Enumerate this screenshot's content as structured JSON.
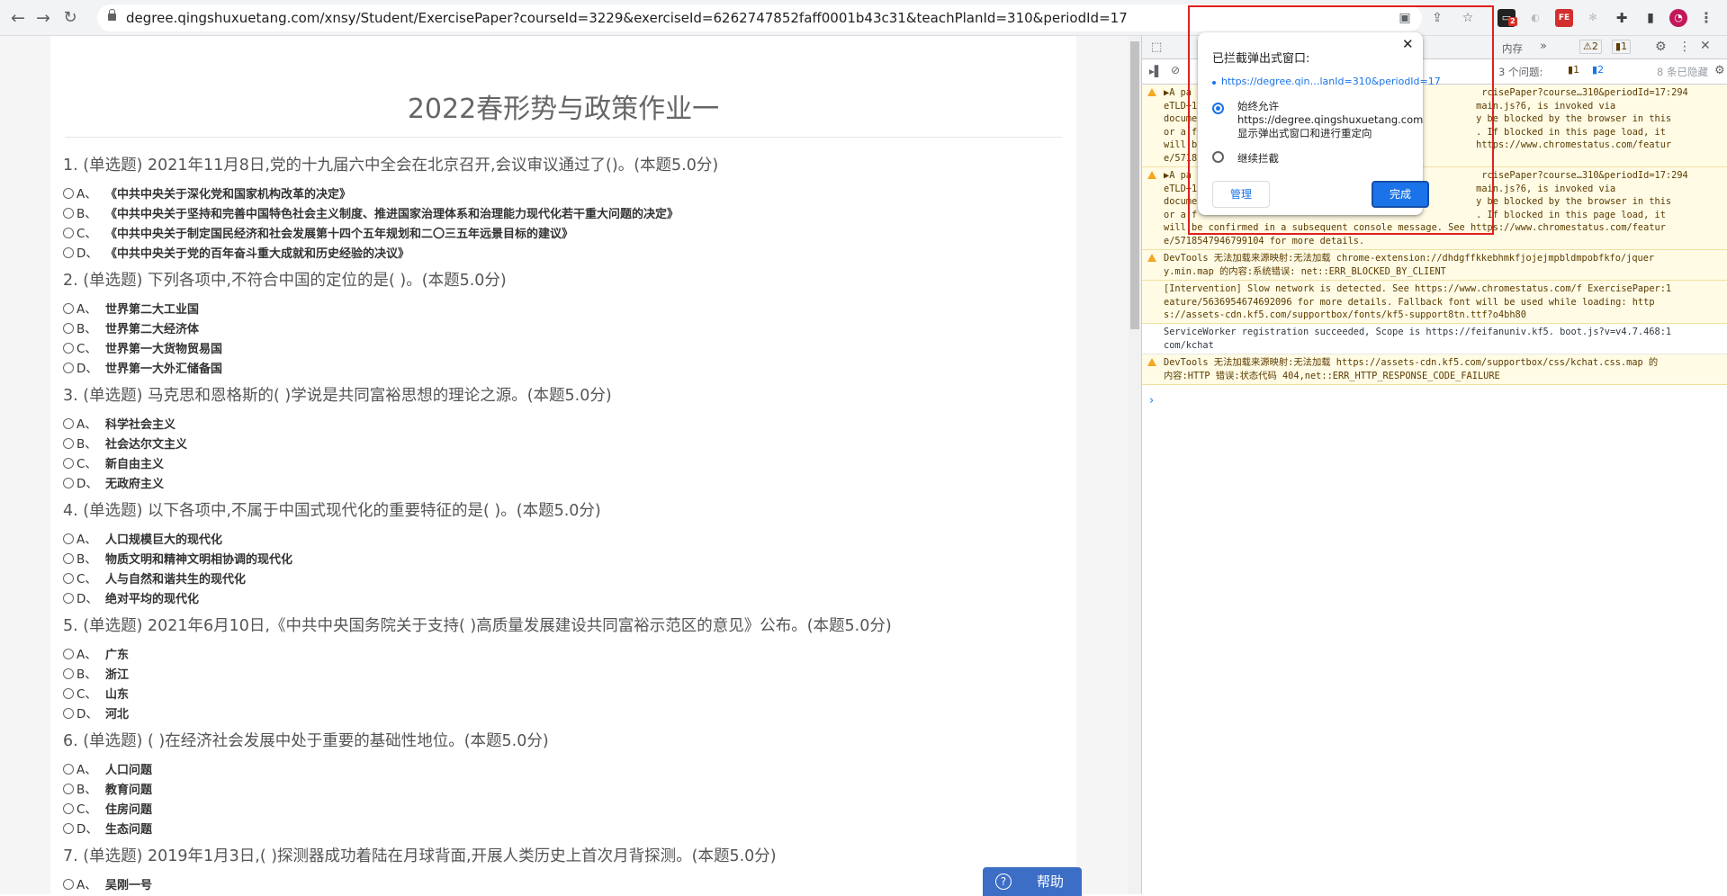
{
  "browser": {
    "url": "degree.qingshuxuetang.com/xnsy/Student/ExercisePaper?courseId=3229&exerciseId=6262747852faff0001b43c31&teachPlanId=310&periodId=17"
  },
  "paper": {
    "title": "2022春形势与政策作业一",
    "questions": [
      {
        "text": "1. (单选题) 2021年11月8日,党的十九届六中全会在北京召开,会议审议通过了()。(本题5.0分)",
        "options": [
          {
            "letter": "A、",
            "text": "《中共中央关于深化党和国家机构改革的决定》"
          },
          {
            "letter": "B、",
            "text": "《中共中央关于坚持和完善中国特色社会主义制度、推进国家治理体系和治理能力现代化若干重大问题的决定》"
          },
          {
            "letter": "C、",
            "text": "《中共中央关于制定国民经济和社会发展第十四个五年规划和二〇三五年远景目标的建议》"
          },
          {
            "letter": "D、",
            "text": "《中共中央关于党的百年奋斗重大成就和历史经验的决议》"
          }
        ]
      },
      {
        "text": "2. (单选题) 下列各项中,不符合中国的定位的是( )。(本题5.0分)",
        "options": [
          {
            "letter": "A、",
            "text": "世界第二大工业国"
          },
          {
            "letter": "B、",
            "text": "世界第二大经济体"
          },
          {
            "letter": "C、",
            "text": "世界第一大货物贸易国"
          },
          {
            "letter": "D、",
            "text": "世界第一大外汇储备国"
          }
        ]
      },
      {
        "text": "3. (单选题) 马克思和恩格斯的( )学说是共同富裕思想的理论之源。(本题5.0分)",
        "options": [
          {
            "letter": "A、",
            "text": "科学社会主义"
          },
          {
            "letter": "B、",
            "text": "社会达尔文主义"
          },
          {
            "letter": "C、",
            "text": "新自由主义"
          },
          {
            "letter": "D、",
            "text": "无政府主义"
          }
        ]
      },
      {
        "text": "4. (单选题) 以下各项中,不属于中国式现代化的重要特征的是( )。(本题5.0分)",
        "options": [
          {
            "letter": "A、",
            "text": "人口规模巨大的现代化"
          },
          {
            "letter": "B、",
            "text": "物质文明和精神文明相协调的现代化"
          },
          {
            "letter": "C、",
            "text": "人与自然和谐共生的现代化"
          },
          {
            "letter": "D、",
            "text": "绝对平均的现代化"
          }
        ]
      },
      {
        "text": "5. (单选题) 2021年6月10日,《中共中央国务院关于支持( )高质量发展建设共同富裕示范区的意见》公布。(本题5.0分)",
        "options": [
          {
            "letter": "A、",
            "text": "广东"
          },
          {
            "letter": "B、",
            "text": "浙江"
          },
          {
            "letter": "C、",
            "text": "山东"
          },
          {
            "letter": "D、",
            "text": "河北"
          }
        ]
      },
      {
        "text": "6. (单选题) ( )在经济社会发展中处于重要的基础性地位。(本题5.0分)",
        "options": [
          {
            "letter": "A、",
            "text": "人口问题"
          },
          {
            "letter": "B、",
            "text": "教育问题"
          },
          {
            "letter": "C、",
            "text": "住房问题"
          },
          {
            "letter": "D、",
            "text": "生态问题"
          }
        ]
      },
      {
        "text": "7. (单选题) 2019年1月3日,( )探测器成功着陆在月球背面,开展人类历史上首次月背探测。(本题5.0分)",
        "options": [
          {
            "letter": "A、",
            "text": "吴刚一号"
          }
        ]
      }
    ],
    "help_label": "帮助"
  },
  "devtools": {
    "tab_memory": "内存",
    "more_tabs": "»",
    "warn_count": "2",
    "issue_count": "1",
    "issues_label": "3 个问题:",
    "issues_warn": "1",
    "issues_info": "2",
    "hidden_label": "8 条已隐藏",
    "messages": [
      {
        "type": "warn",
        "text": "▶A pa                                                    rcisePaper?course…310&periodId=17:294\neTLD+1                                                  main.js?6, is invoked via\ndocume                                                  y be blocked by the browser in this\nor a f                                                  . If blocked in this page load, it\nwill b                                                  https://www.chromestatus.com/featur\ne/5718"
      },
      {
        "type": "warn",
        "text": "▶A pa                                                    rcisePaper?course…310&periodId=17:294\neTLD+1                                                  main.js?6, is invoked via\ndocume                                                  y be blocked by the browser in this\nor a f                                                  . If blocked in this page load, it\nwill be confirmed in a subsequent console message. See https://www.chromestatus.com/featur\ne/5718547946799104 for more details."
      },
      {
        "type": "warn",
        "text": "DevTools 无法加载来源映射:无法加载 chrome-extension://dhdgffkkebhmkfjojejmpbldmpobfkfo/jquer\ny.min.map 的内容:系统错误: net::ERR_BLOCKED_BY_CLIENT"
      },
      {
        "type": "warn-noicon",
        "text": "[Intervention] Slow network is detected. See https://www.chromestatus.com/f ExercisePaper:1\neature/5636954674692096 for more details. Fallback font will be used while loading: http\ns://assets-cdn.kf5.com/supportbox/fonts/kf5-support8tn.ttf?o4bh80"
      },
      {
        "type": "info",
        "text": "ServiceWorker registration succeeded, Scope is https://feifanuniv.kf5. boot.js?v=v4.7.468:1\ncom/kchat"
      },
      {
        "type": "warn",
        "text": "DevTools 无法加载来源映射:无法加载 https://assets-cdn.kf5.com/supportbox/css/kchat.css.map 的\n内容:HTTP 错误:状态代码 404,net::ERR_HTTP_RESPONSE_CODE_FAILURE"
      }
    ],
    "prompt": "›"
  },
  "popup": {
    "title": "已拦截弹出式窗口:",
    "close": "✕",
    "blocked_link": "https://degree.qin…lanId=310&periodId=17",
    "allow_label": "始终允许 https://degree.qingshuxuetang.com 显示弹出式窗口和进行重定向",
    "block_label": "继续拦截",
    "manage_label": "管理",
    "done_label": "完成",
    "selected": "allow"
  },
  "extensions": {
    "badge_count": "2"
  },
  "colors": {
    "accent": "#1a73e8",
    "highlight": "#e02020",
    "help": "#3d6ec6"
  }
}
